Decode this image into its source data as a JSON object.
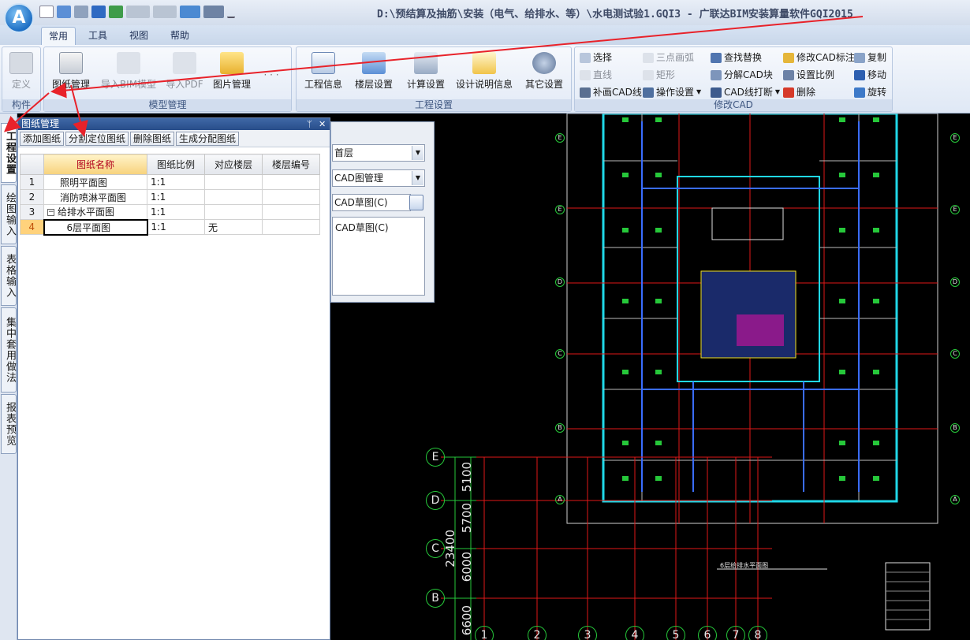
{
  "window": {
    "title": "D:\\预结算及抽筋\\安装（电气、给排水、等）\\水电测试验1.GQI3 - 广联达BIM安装算量软件GQI2015",
    "logo_letter": "A"
  },
  "tabs": [
    "常用",
    "工具",
    "视图",
    "帮助"
  ],
  "ribbon": {
    "groups": {
      "component": "构件",
      "model": "模型管理",
      "project": "工程设置",
      "cad": "修改CAD"
    },
    "define": "定义",
    "drawing_mgmt": "图纸管理",
    "import_bim": "导入BIM模型",
    "import_pdf": "导入PDF",
    "picture_mgmt": "图片管理",
    "more": "· · ·",
    "project_info": "工程信息",
    "floor_settings": "楼层设置",
    "calc_settings": "计算设置",
    "design_notes": "设计说明信息",
    "other_settings": "其它设置",
    "cad_tools": {
      "select": "选择",
      "three_point_arc": "三点画弧",
      "find_replace": "查找替换",
      "modify_cad_label": "修改CAD标注",
      "copy": "复制",
      "line": "直线",
      "rectangle": "矩形",
      "explode_cad_block": "分解CAD块",
      "set_scale": "设置比例",
      "move": "移动",
      "supplement_cad_line": "补画CAD线",
      "operation_settings": "操作设置",
      "break_cad_line": "CAD线打断",
      "delete": "删除",
      "rotate": "旋转"
    }
  },
  "side_tabs": [
    "工程设置",
    "绘图输入",
    "表格输入",
    "集中套用做法",
    "报表预览"
  ],
  "drawing_panel": {
    "title": "图纸管理",
    "pin": "ᛘ",
    "close": "✕",
    "toolbar": [
      "添加图纸",
      "分割定位图纸",
      "删除图纸",
      "生成分配图纸"
    ],
    "columns": [
      "图纸名称",
      "图纸比例",
      "对应楼层",
      "楼层编号"
    ],
    "rows": [
      {
        "index": "1",
        "name": "照明平面图",
        "scale": "1:1",
        "floor": "",
        "floor_no": ""
      },
      {
        "index": "2",
        "name": "消防喷淋平面图",
        "scale": "1:1",
        "floor": "",
        "floor_no": ""
      },
      {
        "index": "3",
        "name": "给排水平面图",
        "scale": "1:1",
        "floor": "",
        "floor_no": "",
        "collapse": "−"
      },
      {
        "index": "4",
        "name": "6层平面图",
        "scale": "1:1",
        "floor": "无",
        "floor_no": ""
      }
    ]
  },
  "floor_panel": {
    "floor_select": "首层",
    "cad_mgmt": "CAD图管理",
    "cad_sketch": "CAD草图(C)",
    "list_item": "CAD草图(C)"
  },
  "cad_drawing": {
    "axis_rows": [
      "E",
      "D",
      "C",
      "B"
    ],
    "axis_cols": [
      "1",
      "2",
      "3",
      "4",
      "5",
      "6",
      "7",
      "8"
    ],
    "dimensions": [
      "5100",
      "5700",
      "23400",
      "6000",
      "6600"
    ],
    "plan_title": "6层给排水平面图",
    "side_axis_right": [
      "E",
      "E",
      "D",
      "C",
      "B",
      "A"
    ],
    "side_axis_left": [
      "E",
      "E",
      "D",
      "C",
      "B",
      "A"
    ]
  },
  "colors": {
    "ribbon_bg": "#dfe8f5",
    "panel_header": "#284d8a",
    "annotation_arrow": "#e8222a",
    "cad_bg": "#000000",
    "cad_cyan": "#20d8e8",
    "cad_red": "#e01818",
    "cad_green": "#26c83a"
  }
}
